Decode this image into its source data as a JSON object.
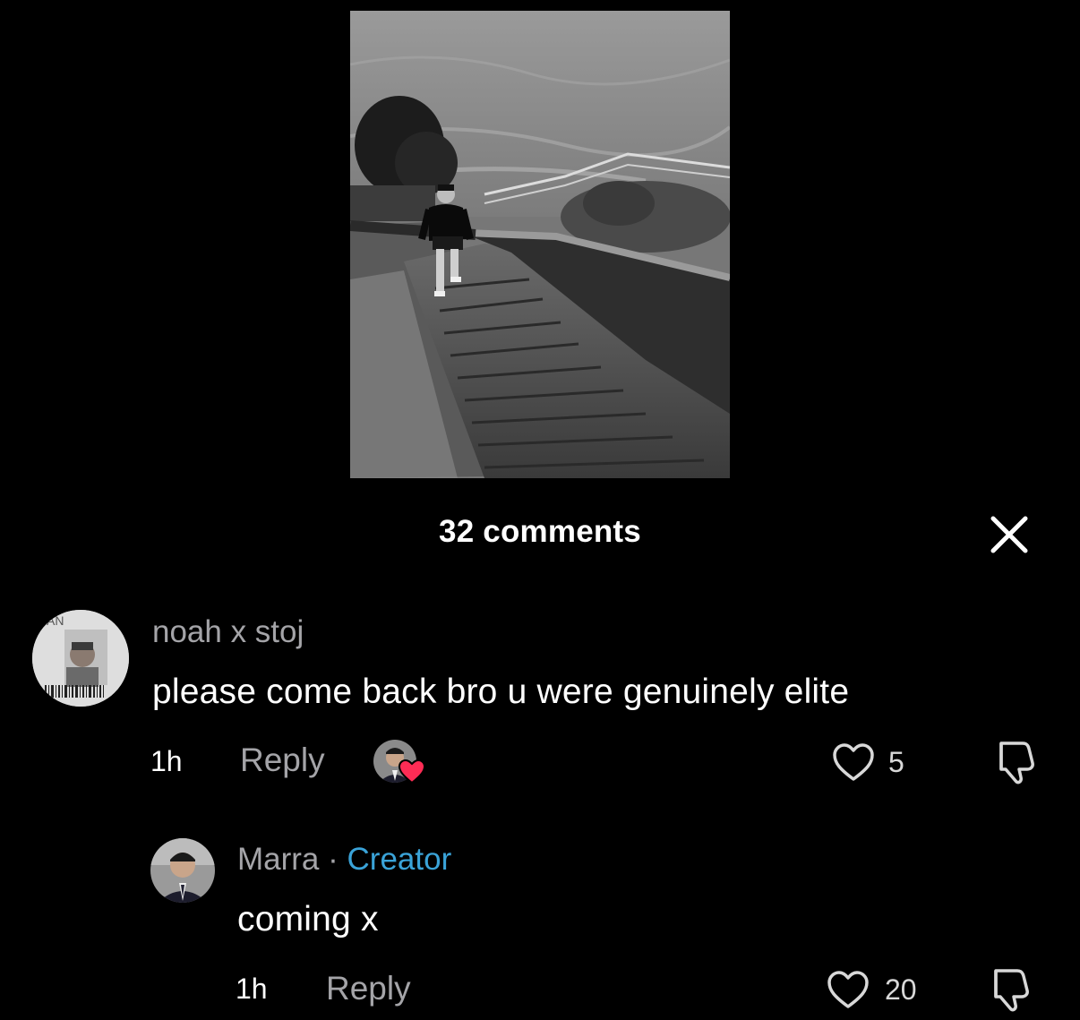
{
  "header": {
    "comments_count_label": "32 comments"
  },
  "comments": [
    {
      "username": "noah x stoj",
      "avatar_text": "AN",
      "text": "please come back bro u were genuinely elite",
      "time": "1h",
      "reply_label": "Reply",
      "likes": "5",
      "creator_liked": true
    },
    {
      "username": "Marra",
      "separator": " · ",
      "badge": "Creator",
      "text": "coming x",
      "time": "1h",
      "reply_label": "Reply",
      "likes": "20"
    }
  ],
  "icons": {
    "close": "close-icon",
    "like": "heart-outline-icon",
    "dislike": "thumbs-down-icon",
    "creator_like": "creator-heart-icon"
  },
  "colors": {
    "background": "#000000",
    "text_primary": "#ffffff",
    "text_secondary": "#a4a4a8",
    "creator_badge": "#3aa3d8",
    "heart_badge": "#fe2c55"
  }
}
